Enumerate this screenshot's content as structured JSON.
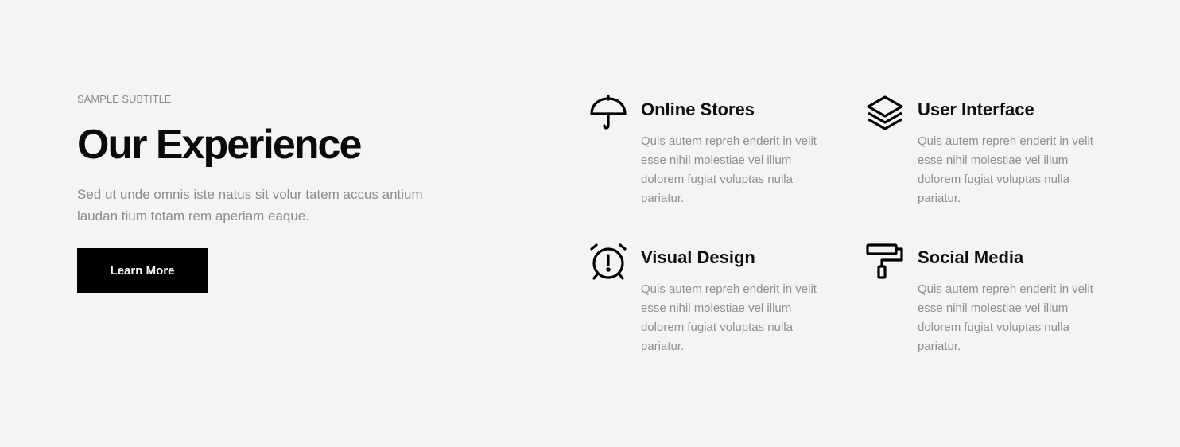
{
  "intro": {
    "subtitle": "SAMPLE SUBTITLE",
    "heading": "Our Experience",
    "description": "Sed ut unde omnis iste natus sit volur tatem accus antium laudan tium totam rem aperiam eaque.",
    "button_label": "Learn More"
  },
  "features": [
    {
      "icon": "umbrella-icon",
      "title": "Online Stores",
      "text": "Quis autem repreh enderit in velit esse nihil molestiae vel illum dolorem fugiat voluptas nulla pariatur."
    },
    {
      "icon": "layers-icon",
      "title": "User Interface",
      "text": "Quis autem repreh enderit in velit esse nihil molestiae vel illum dolorem fugiat voluptas nulla pariatur."
    },
    {
      "icon": "alarm-clock-icon",
      "title": "Visual Design",
      "text": "Quis autem repreh enderit in velit esse nihil molestiae vel illum dolorem fugiat voluptas nulla pariatur."
    },
    {
      "icon": "paint-roller-icon",
      "title": "Social Media",
      "text": "Quis autem repreh enderit in velit esse nihil molestiae vel illum dolorem fugiat voluptas nulla pariatur."
    }
  ],
  "colors": {
    "background": "#f4f4f4",
    "button": "#000000",
    "muted_text": "#8c8c8c"
  }
}
